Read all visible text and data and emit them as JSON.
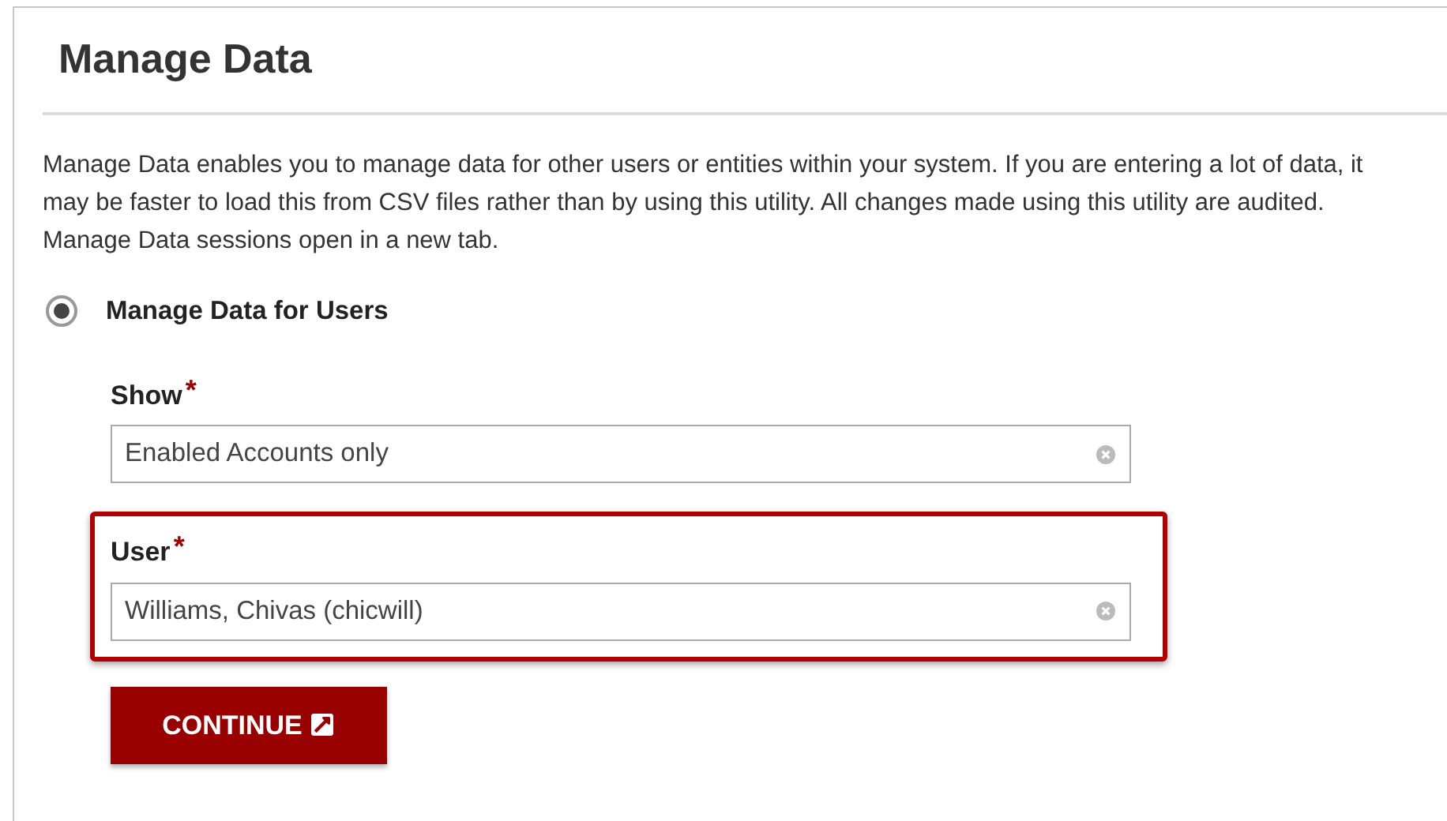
{
  "title": "Manage Data",
  "description": "Manage Data enables you to manage data for other users or entities within your system. If you are entering a lot of data, it may be faster to load this from CSV files rather than by using this utility. All changes made using this utility are audited. Manage Data sessions open in a new tab.",
  "options": [
    {
      "label": "Manage Data for Users",
      "selected": true
    }
  ],
  "fields": [
    {
      "label": "Show",
      "required_mark": "*",
      "value": "Enabled Accounts only",
      "highlighted": false
    },
    {
      "label": "User",
      "required_mark": "*",
      "value": "Williams, Chivas (chicwill)",
      "highlighted": true
    }
  ],
  "continue_button": {
    "label": "CONTINUE"
  }
}
